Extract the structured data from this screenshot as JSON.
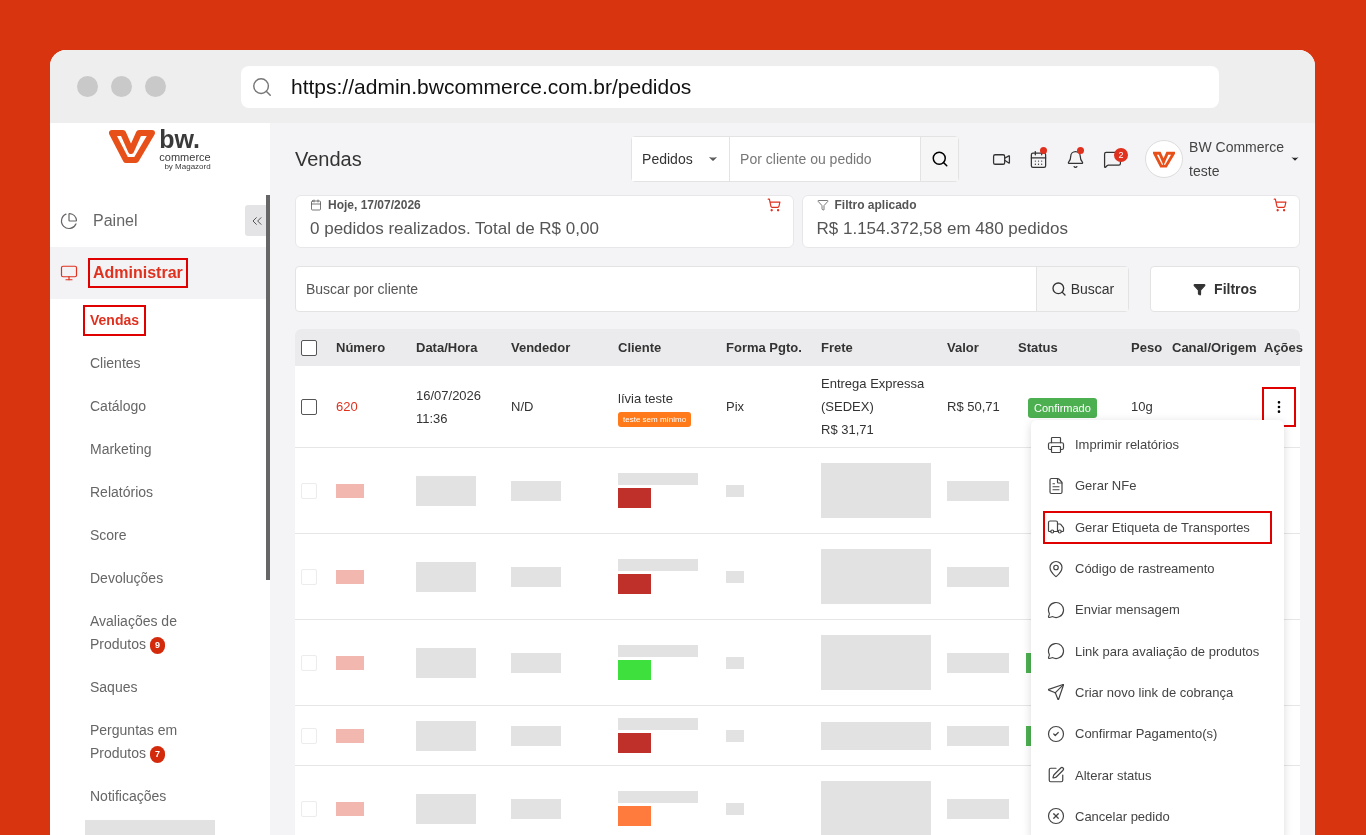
{
  "browser": {
    "url": "https://admin.bwcommerce.com.br/pedidos"
  },
  "logo": {
    "word": "bw.",
    "sub": "commerce",
    "by": "by Magazord"
  },
  "sidebar": {
    "items": [
      {
        "kind": "dashboard",
        "label": "Painel",
        "selected": false,
        "highlighted": false
      },
      {
        "kind": "admin",
        "label": "Administrar",
        "selected": true,
        "highlighted": true,
        "children": [
          {
            "kind": "link",
            "label": "Vendas",
            "selected": true,
            "highlighted": true
          },
          {
            "kind": "link",
            "label": "Clientes",
            "selected": false,
            "highlighted": false
          },
          {
            "kind": "link",
            "label": "Catálogo",
            "selected": false,
            "highlighted": false
          },
          {
            "kind": "link",
            "label": "Marketing",
            "selected": false,
            "highlighted": false
          },
          {
            "kind": "link",
            "label": "Relatórios",
            "selected": false,
            "highlighted": false
          },
          {
            "kind": "link",
            "label": "Score",
            "selected": false,
            "highlighted": false
          },
          {
            "kind": "link",
            "label": "Devoluções",
            "selected": false,
            "highlighted": false
          },
          {
            "kind": "link",
            "label": "Avaliações de Produtos",
            "badge": "9",
            "selected": false,
            "highlighted": false
          },
          {
            "kind": "link",
            "label": "Saques",
            "selected": false,
            "highlighted": false
          },
          {
            "kind": "link",
            "label": "Perguntas em Produtos",
            "badge": "7",
            "selected": false,
            "highlighted": false
          },
          {
            "kind": "link",
            "label": "Notificações",
            "selected": false,
            "highlighted": false
          },
          {
            "kind": "redacted"
          }
        ]
      }
    ]
  },
  "header": {
    "title": "Vendas",
    "search": {
      "scope": "Pedidos",
      "placeholder": "Por cliente ou pedido"
    },
    "icons": [
      {
        "kind": "video",
        "dot": false
      },
      {
        "kind": "calendar",
        "dot": true
      },
      {
        "kind": "bell",
        "dot": true
      },
      {
        "kind": "chat",
        "dot": false,
        "badge": "2"
      }
    ],
    "user": {
      "name": "BW Commerce",
      "sub": "teste"
    }
  },
  "cards": [
    {
      "title": "Hoje, 17/07/2026",
      "text": "0 pedidos realizados. Total de R$ 0,00"
    },
    {
      "title": "Filtro aplicado",
      "text": "R$ 1.154.372,58 em 480 pedidos"
    }
  ],
  "search": {
    "placeholder": "Buscar por cliente",
    "button": "Buscar",
    "filters": "Filtros"
  },
  "table": {
    "select_all": {
      "checked": false
    },
    "columns": [
      "Número",
      "Data/Hora",
      "Vendedor",
      "Cliente",
      "Forma Pgto.",
      "Frete",
      "Valor",
      "Status",
      "Peso",
      "Canal/Origem",
      "Ações"
    ],
    "rows": [
      {
        "kind": "order",
        "checked": false,
        "number": "620",
        "date": "16/07/2026",
        "time": "11:36",
        "seller": "N/D",
        "client": "lívia teste",
        "tag": "teste sem mínimo",
        "payment": "Pix",
        "shipping": [
          "Entrega Expressa",
          "(SEDEX)",
          "R$ 31,71"
        ],
        "value": "R$ 50,71",
        "status": "Confirmado",
        "weight": "10g",
        "actions_highlighted": true
      },
      {
        "kind": "redacted",
        "checked": false,
        "color": "#c0302a",
        "status_badge": false
      },
      {
        "kind": "redacted",
        "checked": false,
        "color": "#c0302a",
        "status_badge": false
      },
      {
        "kind": "redacted",
        "checked": false,
        "color": "#3ee03e",
        "status_badge": true
      },
      {
        "kind": "redacted",
        "checked": false,
        "color": "#c0302a",
        "status_badge": true
      },
      {
        "kind": "redacted",
        "checked": false,
        "color": "#ff7a3d",
        "status_badge": false
      }
    ]
  },
  "menu": {
    "items": [
      {
        "kind": "print",
        "label": "Imprimir relatórios",
        "highlighted": false
      },
      {
        "kind": "invoice",
        "label": "Gerar NFe",
        "highlighted": false
      },
      {
        "kind": "shipping",
        "label": "Gerar Etiqueta de Transportes",
        "highlighted": true
      },
      {
        "kind": "tracking",
        "label": "Código de rastreamento",
        "highlighted": false
      },
      {
        "kind": "message",
        "label": "Enviar mensagem",
        "highlighted": false
      },
      {
        "kind": "message",
        "label": "Link para avaliação de produtos",
        "highlighted": false
      },
      {
        "kind": "payment",
        "label": "Criar novo link de cobrança",
        "highlighted": false
      },
      {
        "kind": "confirm",
        "label": "Confirmar Pagamento(s)",
        "highlighted": false
      },
      {
        "kind": "edit",
        "label": "Alterar status",
        "highlighted": false
      },
      {
        "kind": "cancel",
        "label": "Cancelar pedido",
        "highlighted": false
      }
    ]
  }
}
